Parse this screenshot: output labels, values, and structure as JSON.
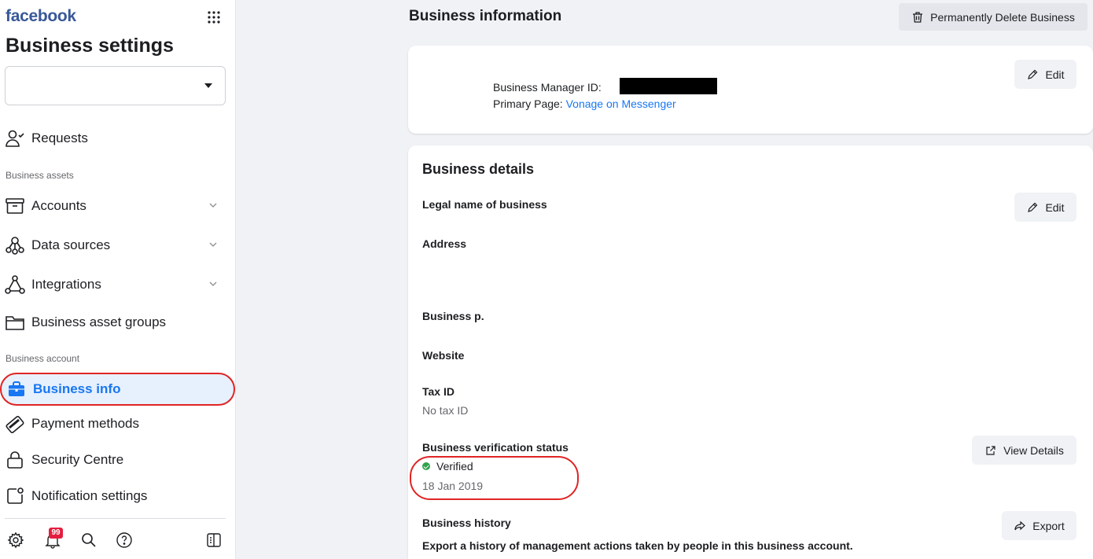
{
  "app": {
    "brand": "facebook",
    "title": "Business settings"
  },
  "colors": {
    "accent": "#1877f2",
    "highlight": "#e02424",
    "verified": "#31a24c",
    "badge": "#e41e3f"
  },
  "sidebar": {
    "business_account_selector": {
      "value": ""
    },
    "requests": {
      "label": "Requests",
      "icon": "person-check-icon"
    },
    "section_assets": "Business assets",
    "assets": [
      {
        "label": "Accounts",
        "icon": "archive-box-icon"
      },
      {
        "label": "Data sources",
        "icon": "people-network-icon"
      },
      {
        "label": "Integrations",
        "icon": "triangle-nodes-icon"
      },
      {
        "label": "Business asset groups",
        "icon": "folder-icon"
      }
    ],
    "section_account": "Business account",
    "account": [
      {
        "label": "Business info",
        "icon": "briefcase-icon",
        "active": true
      },
      {
        "label": "Payment methods",
        "icon": "card-icon"
      },
      {
        "label": "Security Centre",
        "icon": "lock-icon"
      },
      {
        "label": "Notification settings",
        "icon": "notification-box-icon"
      }
    ],
    "bottom": {
      "notifications_count": "99"
    }
  },
  "main": {
    "title": "Business information",
    "delete_button": "Permanently Delete Business",
    "summary": {
      "manager_id_label": "Business Manager ID: ",
      "primary_page_label": "Primary Page: ",
      "primary_page_link": "Vonage on Messenger",
      "edit_label": "Edit"
    },
    "details": {
      "heading": "Business details",
      "edit_label": "Edit",
      "legal_name_label": "Legal name of business",
      "address_label": "Address",
      "phone_label": "Business p.",
      "website_label": "Website",
      "tax_id_label": "Tax ID",
      "tax_id_value": "No tax ID",
      "verification_label": "Business verification status",
      "verification_status": "Verified",
      "verification_date": "18 Jan 2019",
      "view_details_label": "View Details",
      "history_label": "Business history",
      "export_label": "Export",
      "history_desc": "Export a history of management actions taken by people in this business account."
    }
  }
}
